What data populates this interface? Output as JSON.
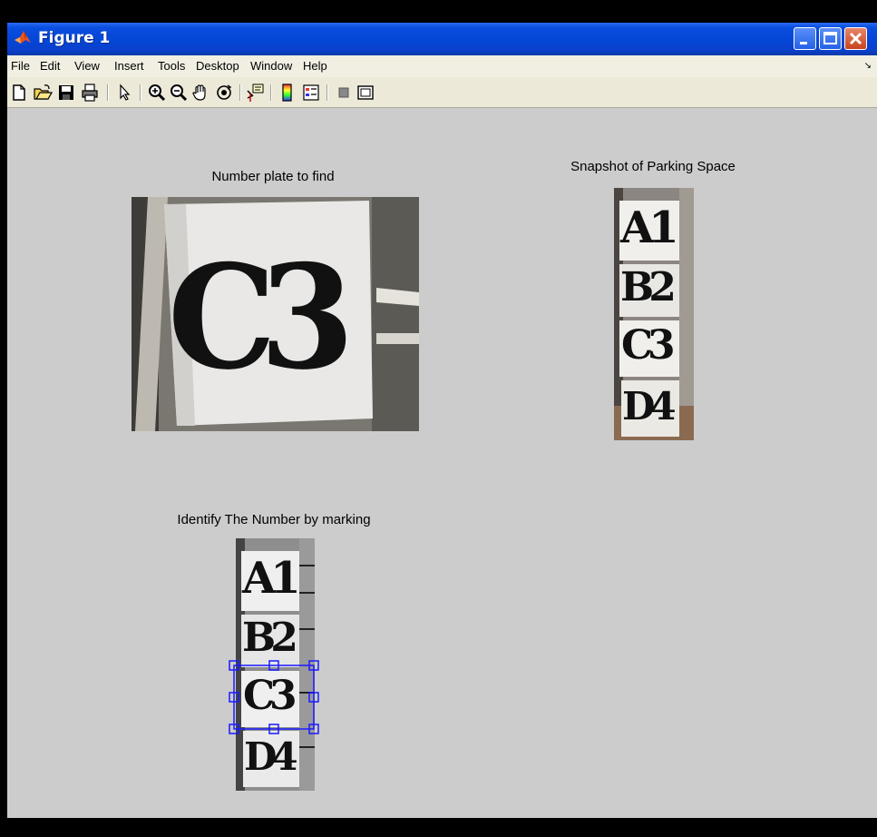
{
  "window": {
    "title": "Figure 1"
  },
  "menu": {
    "items": [
      "File",
      "Edit",
      "View",
      "Insert",
      "Tools",
      "Desktop",
      "Window",
      "Help"
    ],
    "dock_symbol": "↘"
  },
  "toolbar": {
    "icons": [
      "new-figure-icon",
      "open-file-icon",
      "save-figure-icon",
      "print-figure-icon",
      "edit-plot-arrow-icon",
      "zoom-in-icon",
      "zoom-out-icon",
      "pan-hand-icon",
      "rotate-3d-icon",
      "data-cursor-icon",
      "insert-colorbar-icon",
      "insert-legend-icon",
      "hide-plot-tools-icon",
      "show-plot-tools-icon"
    ]
  },
  "panels": {
    "target_plate": {
      "title": "Number plate to find",
      "plate_text": "C3"
    },
    "parking_snapshot": {
      "title": "Snapshot of Parking Space",
      "plates": [
        "A1",
        "B2",
        "C3",
        "D4"
      ]
    },
    "identify": {
      "title": "Identify The Number by marking",
      "plates": [
        "A1",
        "B2",
        "C3",
        "D4"
      ]
    }
  },
  "colors": {
    "titlebar": "#0446d6",
    "figure_bg": "#cccccc",
    "selection": "#1a1aff"
  }
}
